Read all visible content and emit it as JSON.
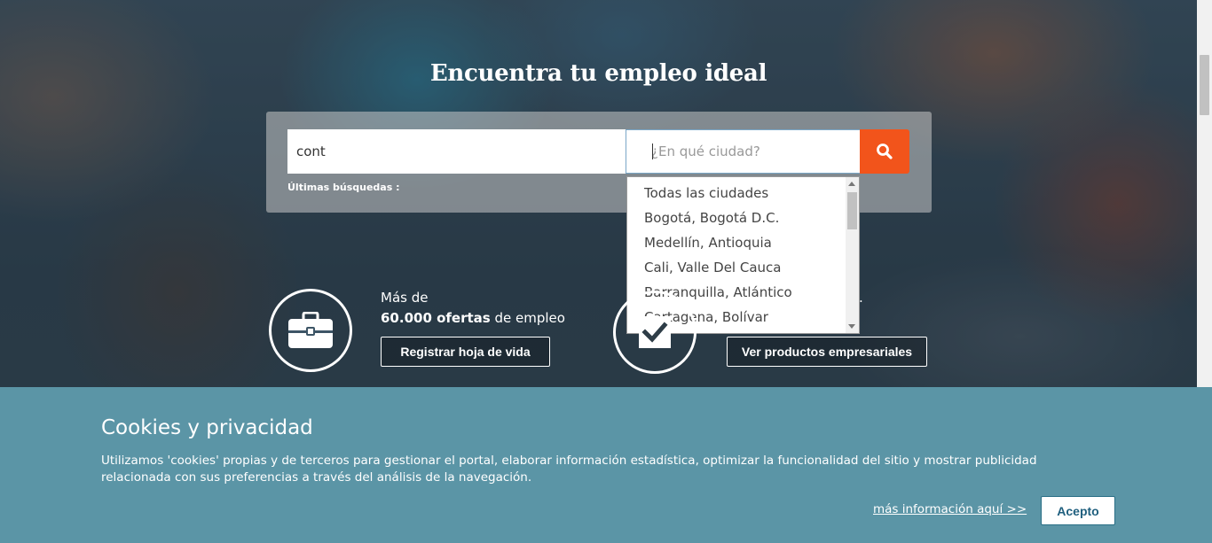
{
  "hero": {
    "headline": "Encuentra tu empleo ideal"
  },
  "search": {
    "keyword_value": "cont",
    "city_placeholder": "¿En qué ciudad?",
    "recent_label": "Últimas búsquedas :",
    "button_icon": "search-icon",
    "button_color": "#f2541b"
  },
  "city_dropdown": {
    "options": [
      "Todas las ciudades",
      "Bogotá, Bogotá D.C.",
      "Medellín, Antioquia",
      "Cali, Valle Del Cauca",
      "Barranquilla, Atlántico",
      "Cartagena, Bolívar"
    ]
  },
  "features": {
    "candidates": {
      "icon": "briefcase-icon",
      "line1": "Más de",
      "line2_bold": "60.000 ofertas",
      "line2_rest": " de empleo",
      "button": "Registrar hoja de vida"
    },
    "companies": {
      "icon": "checkbox-icon",
      "visible_text": ".",
      "button": "Ver productos empresariales"
    }
  },
  "cookies": {
    "title": "Cookies y privacidad",
    "text": "Utilizamos 'cookies' propias y de terceros para gestionar el portal, elaborar información estadística, optimizar la funcionalidad del sitio y mostrar publicidad relacionada con sus preferencias a través del análisis de la navegación.",
    "more_link": "más información aquí >>",
    "accept": "Acepto",
    "background": "#5b95a6"
  }
}
